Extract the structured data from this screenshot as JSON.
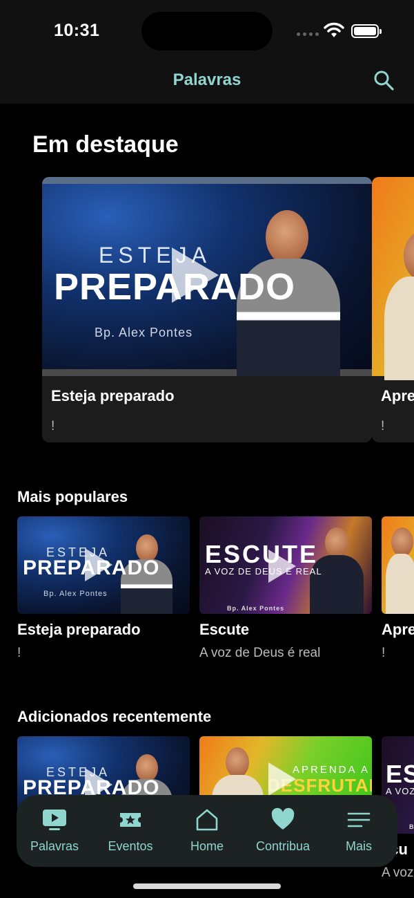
{
  "status_bar": {
    "time": "10:31"
  },
  "nav": {
    "title": "Palavras",
    "search_icon": "search-icon"
  },
  "featured": {
    "heading": "Em destaque",
    "cards": [
      {
        "title": "Esteja preparado",
        "subtitle": "!",
        "art_line1": "ESTEJA",
        "art_line2": "PREPARADO",
        "art_caption": "Bp. Alex Pontes"
      },
      {
        "title": "Apre",
        "subtitle": "!"
      }
    ]
  },
  "popular": {
    "heading": "Mais populares",
    "cards": [
      {
        "title": "Esteja preparado",
        "subtitle": "!",
        "art_line1": "ESTEJA",
        "art_line2": "PREPARADO",
        "art_caption": "Bp. Alex Pontes"
      },
      {
        "title": "Escute",
        "subtitle": "A voz de Deus é real",
        "art_line1": "ESCUTE",
        "art_line2": "A VOZ DE DEUS É REAL",
        "art_caption": "Bp. Alex Pontes"
      },
      {
        "title": "Apre",
        "subtitle": "!"
      }
    ]
  },
  "recent": {
    "heading": "Adicionados recentemente",
    "cards": [
      {
        "title": "",
        "subtitle": "!",
        "art_line1": "ESTEJA",
        "art_line2": "PREPARADO"
      },
      {
        "title": "",
        "subtitle": "!",
        "art_line1": "APRENDA A",
        "art_line2": "DESFRUTAR"
      },
      {
        "title": "scu",
        "subtitle": "A voz",
        "art_line1": "ES",
        "art_line2": "A VOZ",
        "art_caption": "B"
      }
    ]
  },
  "tabbar": {
    "items": [
      {
        "label": "Palavras",
        "icon": "play-screen-icon"
      },
      {
        "label": "Eventos",
        "icon": "ticket-icon"
      },
      {
        "label": "Home",
        "icon": "home-icon"
      },
      {
        "label": "Contribua",
        "icon": "heart-icon"
      },
      {
        "label": "Mais",
        "icon": "menu-icon"
      }
    ]
  },
  "colors": {
    "accent": "#8fd6cf",
    "background": "#000000",
    "bar": "#111111",
    "tabbar": "#1d2222"
  }
}
